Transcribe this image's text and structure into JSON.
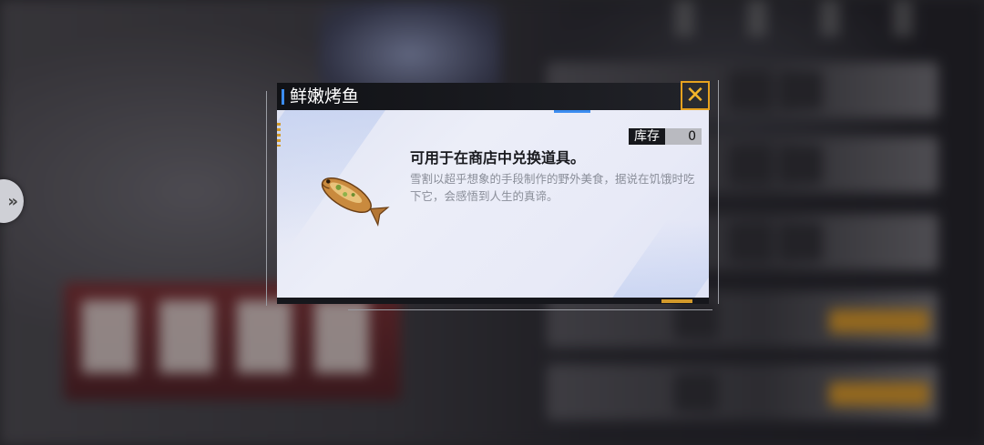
{
  "dialog": {
    "title": "鲜嫩烤鱼",
    "close_icon": "close-icon",
    "stock": {
      "label": "库存",
      "value": "0"
    },
    "heading": "可用于在商店中兑换道具。",
    "description": "雪割以超乎想象的手段制作的野外美食，据说在饥饿时吃下它，会感悟到人生的真谛。",
    "item_icon": "grilled-fish-icon"
  },
  "side_nav": {
    "icon": "double-chevron-right-icon",
    "glyph": "»"
  },
  "colors": {
    "accent_blue": "#3b8cf0",
    "accent_gold": "#e7a21f",
    "panel": "#e8eaf7",
    "header": "#111216"
  }
}
